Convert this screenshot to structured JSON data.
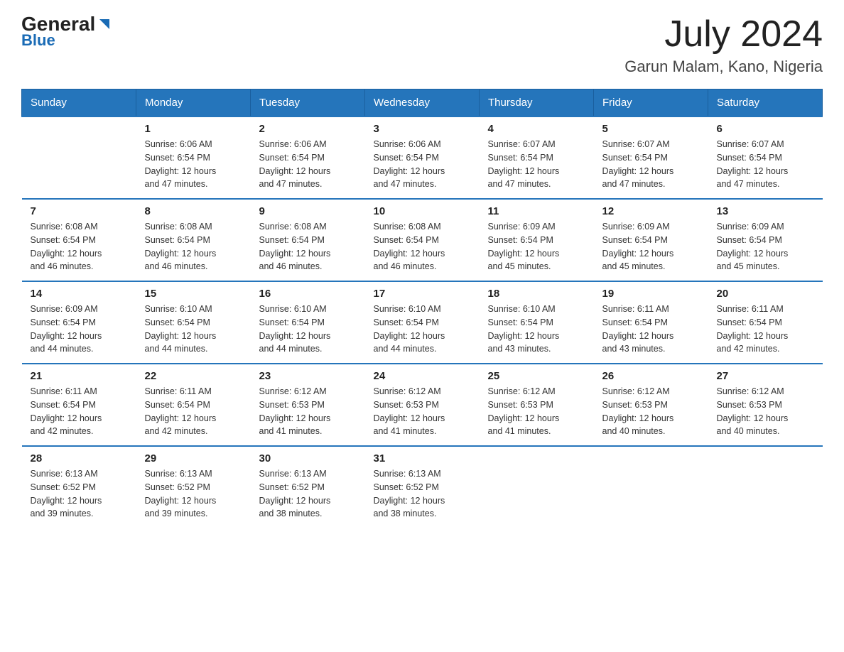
{
  "header": {
    "logo_general": "General",
    "logo_blue": "Blue",
    "month_year": "July 2024",
    "location": "Garun Malam, Kano, Nigeria"
  },
  "days_of_week": [
    "Sunday",
    "Monday",
    "Tuesday",
    "Wednesday",
    "Thursday",
    "Friday",
    "Saturday"
  ],
  "weeks": [
    [
      {
        "num": "",
        "info": ""
      },
      {
        "num": "1",
        "info": "Sunrise: 6:06 AM\nSunset: 6:54 PM\nDaylight: 12 hours\nand 47 minutes."
      },
      {
        "num": "2",
        "info": "Sunrise: 6:06 AM\nSunset: 6:54 PM\nDaylight: 12 hours\nand 47 minutes."
      },
      {
        "num": "3",
        "info": "Sunrise: 6:06 AM\nSunset: 6:54 PM\nDaylight: 12 hours\nand 47 minutes."
      },
      {
        "num": "4",
        "info": "Sunrise: 6:07 AM\nSunset: 6:54 PM\nDaylight: 12 hours\nand 47 minutes."
      },
      {
        "num": "5",
        "info": "Sunrise: 6:07 AM\nSunset: 6:54 PM\nDaylight: 12 hours\nand 47 minutes."
      },
      {
        "num": "6",
        "info": "Sunrise: 6:07 AM\nSunset: 6:54 PM\nDaylight: 12 hours\nand 47 minutes."
      }
    ],
    [
      {
        "num": "7",
        "info": "Sunrise: 6:08 AM\nSunset: 6:54 PM\nDaylight: 12 hours\nand 46 minutes."
      },
      {
        "num": "8",
        "info": "Sunrise: 6:08 AM\nSunset: 6:54 PM\nDaylight: 12 hours\nand 46 minutes."
      },
      {
        "num": "9",
        "info": "Sunrise: 6:08 AM\nSunset: 6:54 PM\nDaylight: 12 hours\nand 46 minutes."
      },
      {
        "num": "10",
        "info": "Sunrise: 6:08 AM\nSunset: 6:54 PM\nDaylight: 12 hours\nand 46 minutes."
      },
      {
        "num": "11",
        "info": "Sunrise: 6:09 AM\nSunset: 6:54 PM\nDaylight: 12 hours\nand 45 minutes."
      },
      {
        "num": "12",
        "info": "Sunrise: 6:09 AM\nSunset: 6:54 PM\nDaylight: 12 hours\nand 45 minutes."
      },
      {
        "num": "13",
        "info": "Sunrise: 6:09 AM\nSunset: 6:54 PM\nDaylight: 12 hours\nand 45 minutes."
      }
    ],
    [
      {
        "num": "14",
        "info": "Sunrise: 6:09 AM\nSunset: 6:54 PM\nDaylight: 12 hours\nand 44 minutes."
      },
      {
        "num": "15",
        "info": "Sunrise: 6:10 AM\nSunset: 6:54 PM\nDaylight: 12 hours\nand 44 minutes."
      },
      {
        "num": "16",
        "info": "Sunrise: 6:10 AM\nSunset: 6:54 PM\nDaylight: 12 hours\nand 44 minutes."
      },
      {
        "num": "17",
        "info": "Sunrise: 6:10 AM\nSunset: 6:54 PM\nDaylight: 12 hours\nand 44 minutes."
      },
      {
        "num": "18",
        "info": "Sunrise: 6:10 AM\nSunset: 6:54 PM\nDaylight: 12 hours\nand 43 minutes."
      },
      {
        "num": "19",
        "info": "Sunrise: 6:11 AM\nSunset: 6:54 PM\nDaylight: 12 hours\nand 43 minutes."
      },
      {
        "num": "20",
        "info": "Sunrise: 6:11 AM\nSunset: 6:54 PM\nDaylight: 12 hours\nand 42 minutes."
      }
    ],
    [
      {
        "num": "21",
        "info": "Sunrise: 6:11 AM\nSunset: 6:54 PM\nDaylight: 12 hours\nand 42 minutes."
      },
      {
        "num": "22",
        "info": "Sunrise: 6:11 AM\nSunset: 6:54 PM\nDaylight: 12 hours\nand 42 minutes."
      },
      {
        "num": "23",
        "info": "Sunrise: 6:12 AM\nSunset: 6:53 PM\nDaylight: 12 hours\nand 41 minutes."
      },
      {
        "num": "24",
        "info": "Sunrise: 6:12 AM\nSunset: 6:53 PM\nDaylight: 12 hours\nand 41 minutes."
      },
      {
        "num": "25",
        "info": "Sunrise: 6:12 AM\nSunset: 6:53 PM\nDaylight: 12 hours\nand 41 minutes."
      },
      {
        "num": "26",
        "info": "Sunrise: 6:12 AM\nSunset: 6:53 PM\nDaylight: 12 hours\nand 40 minutes."
      },
      {
        "num": "27",
        "info": "Sunrise: 6:12 AM\nSunset: 6:53 PM\nDaylight: 12 hours\nand 40 minutes."
      }
    ],
    [
      {
        "num": "28",
        "info": "Sunrise: 6:13 AM\nSunset: 6:52 PM\nDaylight: 12 hours\nand 39 minutes."
      },
      {
        "num": "29",
        "info": "Sunrise: 6:13 AM\nSunset: 6:52 PM\nDaylight: 12 hours\nand 39 minutes."
      },
      {
        "num": "30",
        "info": "Sunrise: 6:13 AM\nSunset: 6:52 PM\nDaylight: 12 hours\nand 38 minutes."
      },
      {
        "num": "31",
        "info": "Sunrise: 6:13 AM\nSunset: 6:52 PM\nDaylight: 12 hours\nand 38 minutes."
      },
      {
        "num": "",
        "info": ""
      },
      {
        "num": "",
        "info": ""
      },
      {
        "num": "",
        "info": ""
      }
    ]
  ]
}
